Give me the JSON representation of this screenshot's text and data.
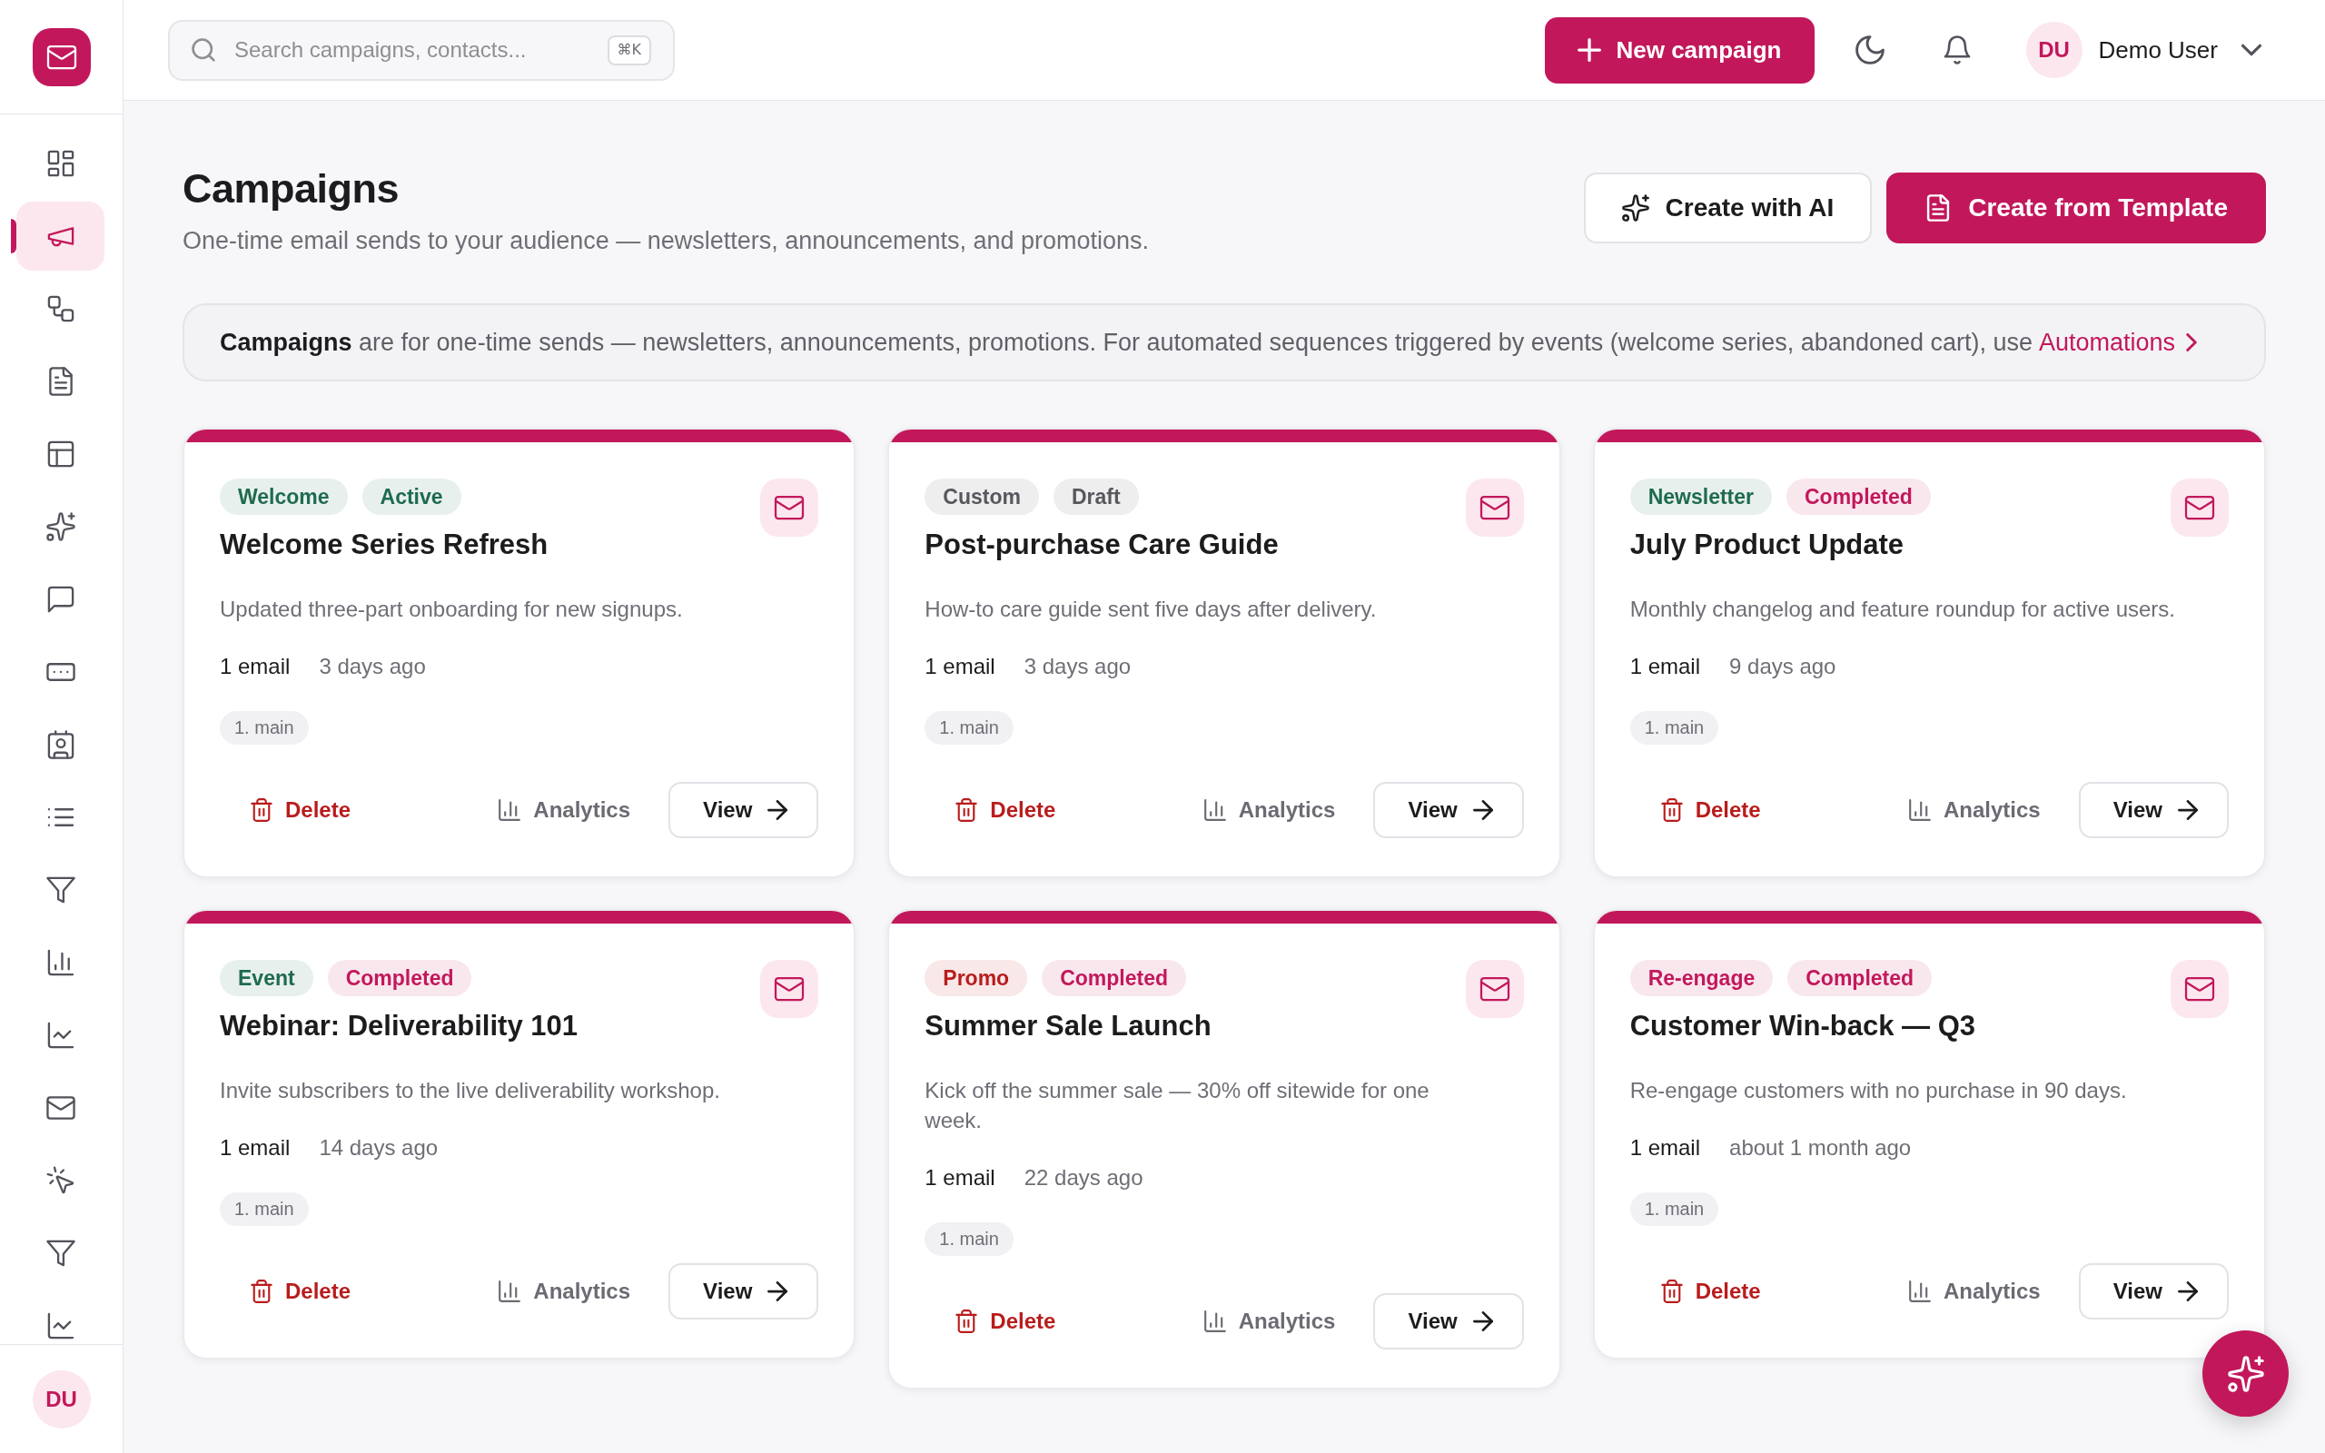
{
  "sidebar": {
    "items": [
      {
        "kind": "grid",
        "selected": false
      },
      {
        "kind": "megaphone",
        "selected": true
      },
      {
        "kind": "workflow",
        "selected": false
      },
      {
        "kind": "document",
        "selected": false
      },
      {
        "kind": "layout",
        "selected": false
      },
      {
        "kind": "sparkles",
        "selected": false
      },
      {
        "kind": "message",
        "selected": false
      },
      {
        "kind": "ellipsis",
        "selected": false
      },
      {
        "kind": "contact",
        "selected": false
      },
      {
        "kind": "list",
        "selected": false
      },
      {
        "kind": "funnel",
        "selected": false
      },
      {
        "kind": "bars",
        "selected": false
      },
      {
        "kind": "trend",
        "selected": false
      },
      {
        "kind": "mail",
        "selected": false
      },
      {
        "kind": "pointer",
        "selected": false
      },
      {
        "kind": "funnel",
        "selected": false
      },
      {
        "kind": "trend",
        "selected": false
      }
    ],
    "user_initials": "DU"
  },
  "topbar": {
    "search": {
      "placeholder": "Search campaigns, contacts...",
      "shortcut": "⌘K"
    },
    "new_campaign_button": "New campaign",
    "user": {
      "initials": "DU",
      "name": "Demo User"
    }
  },
  "page_header": {
    "title": "Campaigns",
    "subtitle": "One-time email sends to your audience — newsletters, announcements, and promotions.",
    "buttons": [
      {
        "label": "Create with AI",
        "kind": "ai"
      },
      {
        "label": "Create from Template",
        "kind": "template"
      }
    ]
  },
  "info_banner": {
    "text": "**Campaigns** are for one-time sends — newsletters, announcements, promotions. For automated sequences triggered by events (welcome series, abandoned cart), use",
    "link": "Automations"
  },
  "cards": [
    {
      "tags": [
        {
          "label": "Welcome",
          "color": "#1f6b4f"
        },
        {
          "label": "Active",
          "color": "#1f6b4f"
        }
      ],
      "title": "Welcome Series Refresh",
      "description": "Updated three-part onboarding for new signups.",
      "email_count": "1 email",
      "updated": "3 days ago",
      "steps": [
        "1. main"
      ],
      "delete": "Delete",
      "analytics": "Analytics",
      "view": "View"
    },
    {
      "tags": [
        {
          "label": "Custom",
          "color": "#57575e"
        },
        {
          "label": "Draft",
          "color": "#57575e"
        }
      ],
      "title": "Post-purchase Care Guide",
      "description": "How-to care guide sent five days after delivery.",
      "email_count": "1 email",
      "updated": "3 days ago",
      "steps": [
        "1. main"
      ],
      "delete": "Delete",
      "analytics": "Analytics",
      "view": "View"
    },
    {
      "tags": [
        {
          "label": "Newsletter",
          "color": "#1f6b4f"
        },
        {
          "label": "Completed",
          "color": "#c2185b"
        }
      ],
      "title": "July Product Update",
      "description": "Monthly changelog and feature roundup for active users.",
      "email_count": "1 email",
      "updated": "9 days ago",
      "steps": [
        "1. main"
      ],
      "delete": "Delete",
      "analytics": "Analytics",
      "view": "View"
    },
    {
      "tags": [
        {
          "label": "Event",
          "color": "#1f6b4f"
        },
        {
          "label": "Completed",
          "color": "#c2185b"
        }
      ],
      "title": "Webinar: Deliverability 101",
      "description": "Invite subscribers to the live deliverability workshop.",
      "email_count": "1 email",
      "updated": "14 days ago",
      "steps": [
        "1. main"
      ],
      "delete": "Delete",
      "analytics": "Analytics",
      "view": "View"
    },
    {
      "tags": [
        {
          "label": "Promo",
          "color": "#b91c1c"
        },
        {
          "label": "Completed",
          "color": "#c2185b"
        }
      ],
      "title": "Summer Sale Launch",
      "description": "Kick off the summer sale — 30% off sitewide for one week.",
      "email_count": "1 email",
      "updated": "22 days ago",
      "steps": [
        "1. main"
      ],
      "delete": "Delete",
      "analytics": "Analytics",
      "view": "View"
    },
    {
      "tags": [
        {
          "label": "Re-engage",
          "color": "#c2185b"
        },
        {
          "label": "Completed",
          "color": "#c2185b"
        }
      ],
      "title": "Customer Win-back — Q3",
      "description": "Re-engage customers with no purchase in 90 days.",
      "email_count": "1 email",
      "updated": "about 1 month ago",
      "steps": [
        "1. main"
      ],
      "delete": "Delete",
      "analytics": "Analytics",
      "view": "View"
    }
  ]
}
